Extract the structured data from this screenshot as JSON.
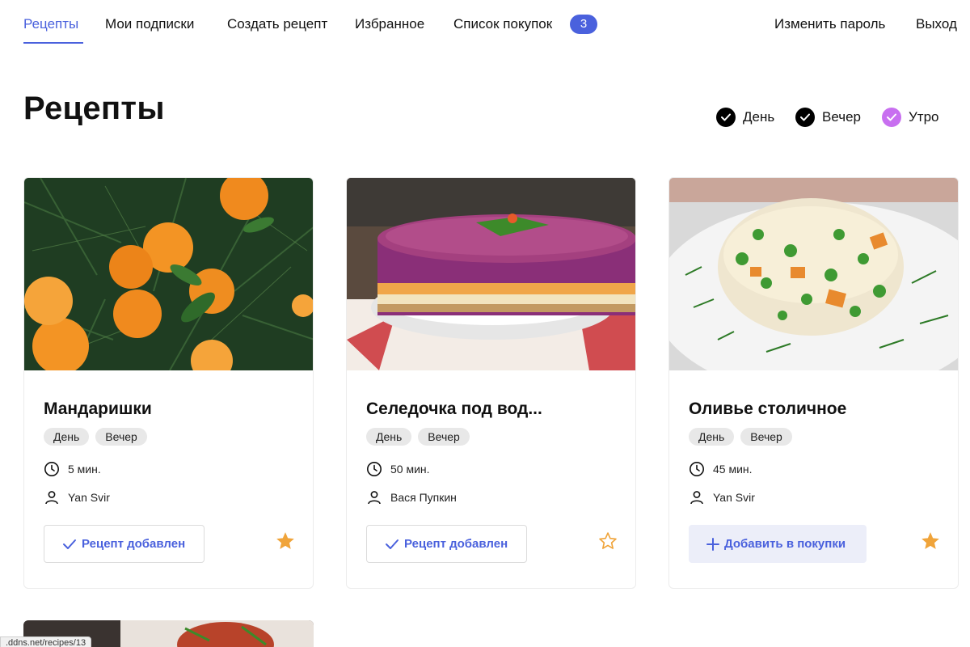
{
  "nav": {
    "items": [
      {
        "label": "Рецепты",
        "active": true
      },
      {
        "label": "Мои подписки"
      },
      {
        "label": "Создать рецепт"
      },
      {
        "label": "Избранное"
      },
      {
        "label": "Список покупок"
      }
    ],
    "cart_count": "3",
    "change_password": "Изменить пароль",
    "logout": "Выход"
  },
  "page": {
    "title": "Рецепты"
  },
  "filters": [
    {
      "label": "День",
      "checked": true,
      "color": "#000000"
    },
    {
      "label": "Вечер",
      "checked": true,
      "color": "#000000"
    },
    {
      "label": "Утро",
      "checked": true,
      "color": "#c86ff0"
    }
  ],
  "recipes": [
    {
      "title": "Мандаришки",
      "tags": [
        "День",
        "Вечер"
      ],
      "time": "5 мин.",
      "author": "Yan Svir",
      "button_label": "Рецепт добавлен",
      "button_state": "added",
      "favorite": true
    },
    {
      "title": "Селедочка под вод...",
      "tags": [
        "День",
        "Вечер"
      ],
      "time": "50 мин.",
      "author": "Вася Пупкин",
      "button_label": "Рецепт добавлен",
      "button_state": "added",
      "favorite": false
    },
    {
      "title": "Оливье столичное",
      "tags": [
        "День",
        "Вечер"
      ],
      "time": "45 мин.",
      "author": "Yan Svir",
      "button_label": "Добавить в покупки",
      "button_state": "add",
      "favorite": true
    }
  ],
  "status_bar": {
    "url": ".ddns.net/recipes/13"
  },
  "colors": {
    "accent": "#4a61dd",
    "star": "#f0a43a",
    "tag_bg": "#e8e8e8"
  },
  "icons": {
    "time": "clock-icon",
    "author": "user-icon",
    "added": "check-icon",
    "add": "plus-icon",
    "favorite": "star-icon",
    "filter": "check-circle-icon"
  }
}
